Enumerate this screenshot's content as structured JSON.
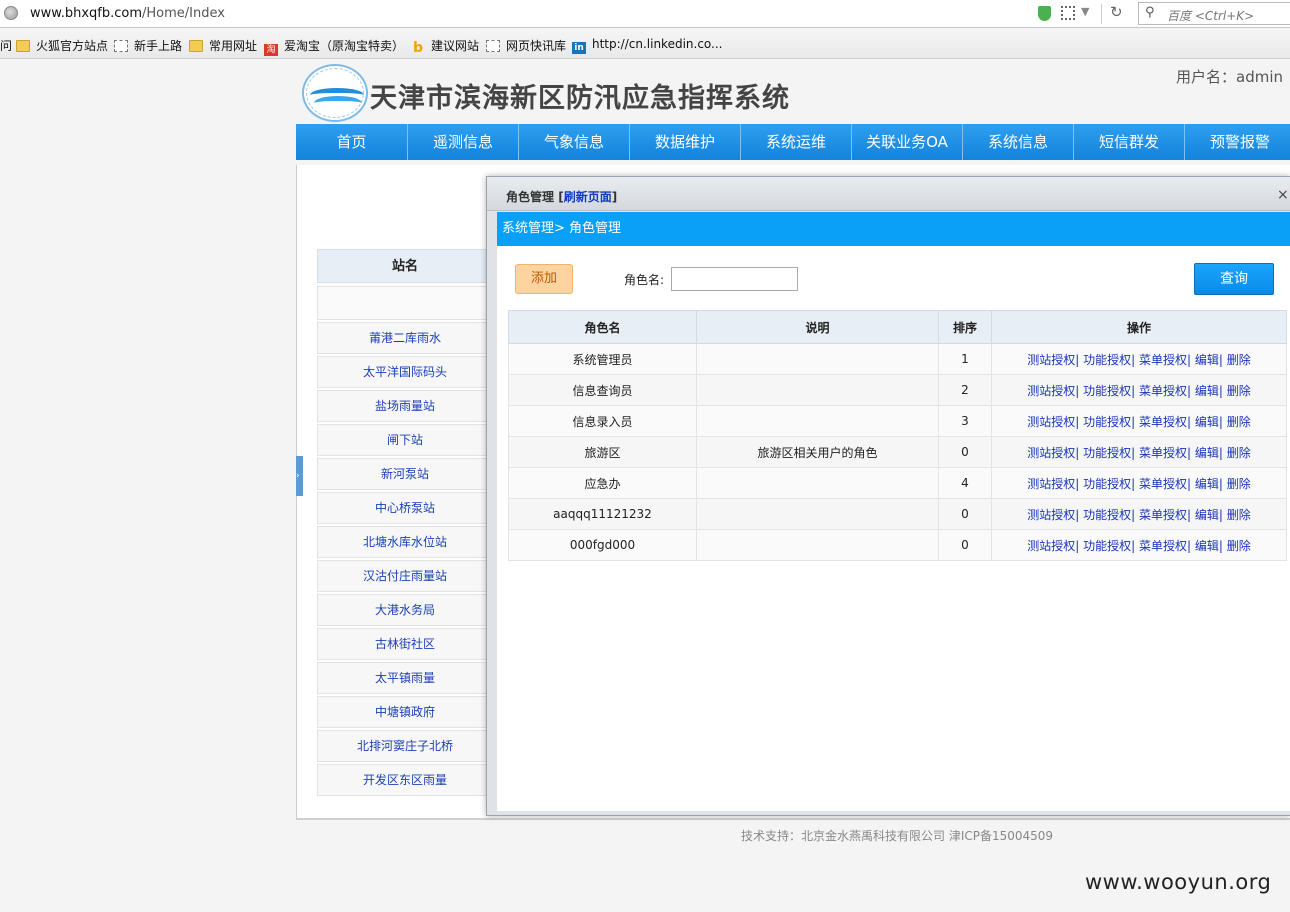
{
  "browser": {
    "url_domain": "www.bhxqfb.com",
    "url_path": "/Home/Index",
    "search_placeholder": "百度 <Ctrl+K>",
    "bookmarks": [
      {
        "label": "火狐官方站点",
        "icon": "folder-icon"
      },
      {
        "label": "新手上路",
        "icon": "page-icon"
      },
      {
        "label": "常用网址",
        "icon": "folder-icon"
      },
      {
        "label": "爱淘宝（原淘宝特卖）",
        "icon": "taobao-icon"
      },
      {
        "label": "建议网站",
        "icon": "bing-icon"
      },
      {
        "label": "网页快讯库",
        "icon": "page-icon"
      },
      {
        "label": "http://cn.linkedin.co...",
        "icon": "linkedin-icon"
      }
    ],
    "bookmark_cut_prefix": "问"
  },
  "header": {
    "site_title": "天津市滨海新区防汛应急指挥系统",
    "user_label": "用户名：admin"
  },
  "nav": [
    "首页",
    "遥测信息",
    "气象信息",
    "数据维护",
    "系统运维",
    "关联业务OA",
    "系统信息",
    "短信群发",
    "预警报警"
  ],
  "stations": {
    "header": "站名",
    "rows": [
      "莆港二库雨水",
      "太平洋国际码头",
      "盐场雨量站",
      "闸下站",
      "新河泵站",
      "中心桥泵站",
      "北塘水库水位站",
      "汉沽付庄雨量站",
      "大港水务局",
      "古林街社区",
      "太平镇雨量",
      "中塘镇政府",
      "北排河窦庄子北桥",
      "开发区东区雨量"
    ]
  },
  "dialog": {
    "title": "角色管理",
    "refresh": "刷新页面",
    "close": "×",
    "breadcrumb": "系统管理> 角色管理",
    "add_label": "添加",
    "role_name_label": "角色名:",
    "role_name_value": "",
    "query_label": "查询",
    "columns": [
      "角色名",
      "说明",
      "排序",
      "操作"
    ],
    "actions": [
      "测站授权",
      "功能授权",
      "菜单授权",
      "编辑",
      "删除"
    ],
    "rows": [
      {
        "name": "系统管理员",
        "desc": "",
        "order": "1"
      },
      {
        "name": "信息查询员",
        "desc": "",
        "order": "2"
      },
      {
        "name": "信息录入员",
        "desc": "",
        "order": "3"
      },
      {
        "name": "旅游区",
        "desc": "旅游区相关用户的角色",
        "order": "0"
      },
      {
        "name": "应急办",
        "desc": "",
        "order": "4"
      },
      {
        "name": "aaqqq11121232",
        "desc": "",
        "order": "0"
      },
      {
        "name": "000fgd000",
        "desc": "",
        "order": "0"
      }
    ]
  },
  "footer": "技术支持：北京金水燕禹科技有限公司  津ICP备15004509",
  "watermark": "www.wooyun.org",
  "colors": {
    "nav": "#1a8ee6",
    "breadcrumb": "#0aa0f8",
    "link": "#1a34b5",
    "add_button": "#fdd3a0"
  }
}
